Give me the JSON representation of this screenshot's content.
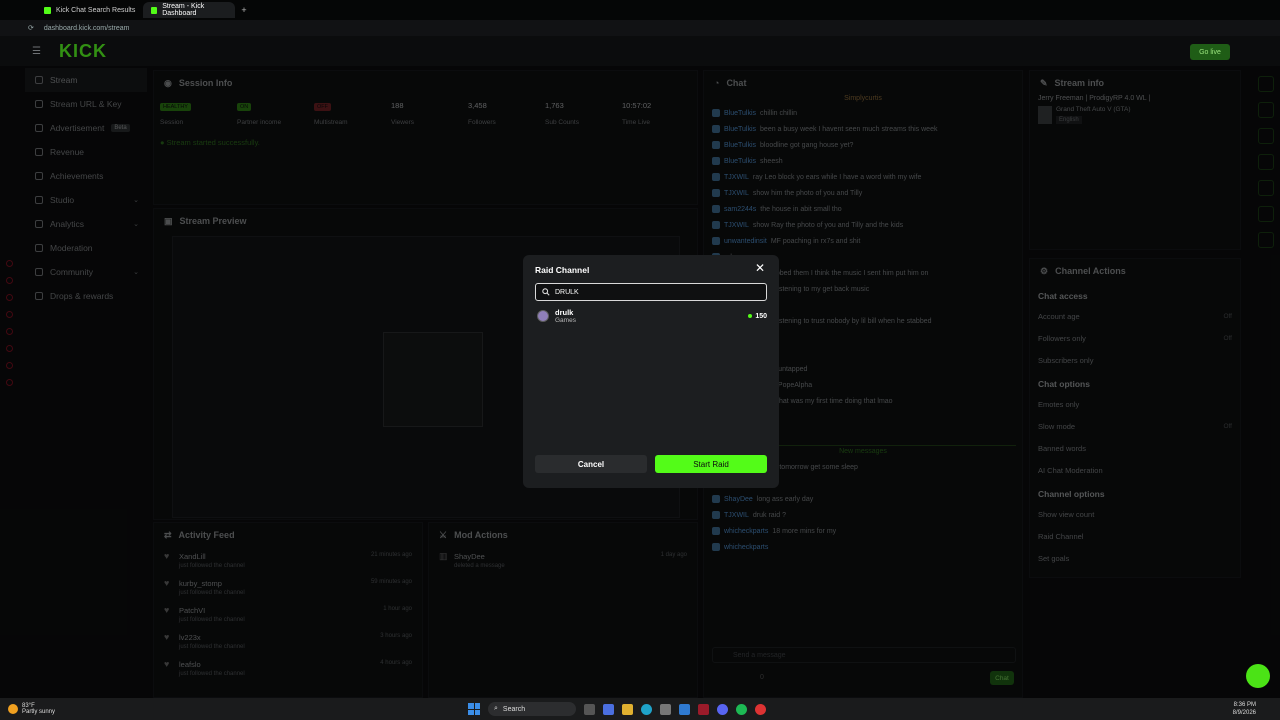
{
  "browser": {
    "tabs": [
      {
        "title": "Kick Chat Search Results",
        "active": false
      },
      {
        "title": "Stream - Kick Dashboard",
        "active": true
      }
    ],
    "url": "dashboard.kick.com/stream"
  },
  "header": {
    "logo": "KICK",
    "go_live": "Go live"
  },
  "sidebar": {
    "items": [
      {
        "label": "Stream",
        "icon": "broadcast-icon",
        "active": true
      },
      {
        "label": "Stream URL & Key",
        "icon": "key-icon"
      },
      {
        "label": "Advertisement",
        "icon": "megaphone-icon",
        "badge": "Beta"
      },
      {
        "label": "Revenue",
        "icon": "dollar-icon"
      },
      {
        "label": "Achievements",
        "icon": "trophy-icon"
      },
      {
        "label": "Studio",
        "icon": "studio-icon",
        "chevron": true
      },
      {
        "label": "Analytics",
        "icon": "chart-icon",
        "chevron": true
      },
      {
        "label": "Moderation",
        "icon": "shield-icon"
      },
      {
        "label": "Community",
        "icon": "people-icon",
        "chevron": true
      },
      {
        "label": "Drops & rewards",
        "icon": "gift-icon"
      }
    ]
  },
  "session": {
    "title": "Session Info",
    "stats": [
      {
        "pill": "HEALTHY",
        "label": "Session",
        "color": "#53fc18"
      },
      {
        "pill": "ON",
        "label": "Partner income",
        "color": "#53fc18"
      },
      {
        "pill": "OFF",
        "label": "Multistream",
        "color": "#e5363a"
      },
      {
        "value": "188",
        "label": "Viewers"
      },
      {
        "value": "3,458",
        "label": "Followers"
      },
      {
        "value": "1,763",
        "label": "Sub Counts"
      },
      {
        "value": "10:57:02",
        "label": "Time Live"
      }
    ],
    "status": "Stream started successfully."
  },
  "preview": {
    "title": "Stream Preview"
  },
  "activity": {
    "title": "Activity Feed",
    "items": [
      {
        "name": "XandLill",
        "sub": "just followed the channel",
        "time": "21 minutes ago"
      },
      {
        "name": "kurby_stomp",
        "sub": "just followed the channel",
        "time": "59 minutes ago"
      },
      {
        "name": "PatchVI",
        "sub": "just followed the channel",
        "time": "1 hour ago"
      },
      {
        "name": "lv223x",
        "sub": "just followed the channel",
        "time": "3 hours ago"
      },
      {
        "name": "leafslo",
        "sub": "just followed the channel",
        "time": "4 hours ago"
      }
    ]
  },
  "mod_actions": {
    "title": "Mod Actions",
    "items": [
      {
        "name": "ShayDee",
        "sub": "deleted a message",
        "time": "1 day ago"
      }
    ]
  },
  "chat": {
    "title": "Chat",
    "pinned": "Simplycurtis",
    "lines": [
      {
        "user": "BlueTulkis",
        "text": "chillin chillin"
      },
      {
        "user": "BlueTulkis",
        "text": "been a busy week I havent seen much streams this week"
      },
      {
        "user": "BlueTulkis",
        "text": "bloodline got gang house yet?"
      },
      {
        "user": "BlueTulkis",
        "text": "sheesh"
      },
      {
        "user": "TJXWIL",
        "text": "ray Leo block yo ears while I have a word with my wife"
      },
      {
        "user": "TJXWIL",
        "text": "show him the photo of you and Tilly"
      },
      {
        "user": "sam2244s",
        "text": "the house in abit small tho"
      },
      {
        "user": "TJXWIL",
        "text": "show Ray the photo of you and Tilly and the kids"
      },
      {
        "user": "unwantedinsit",
        "text": "MF poaching in rx7s and shit"
      },
      {
        "user": "",
        "text": "dream:"
      },
      {
        "user": "",
        "text": "dream: Levi stabbed them I think the music I sent him put him on"
      },
      {
        "user": "",
        "text": "dream: he was listening to my get back music"
      },
      {
        "user": "",
        "text": "dream: lol"
      },
      {
        "user": "",
        "text": "dream: he was listening to trust nobody by lil bill when he stabbed"
      },
      {
        "user": "",
        "text": "levis stream"
      },
      {
        "user": "",
        "text": "is funny"
      },
      {
        "user": "",
        "text": "https://kick.com/untapped"
      },
      {
        "user": "",
        "text": "boom for you @PopeAlpha"
      },
      {
        "user": "",
        "text": "sorry I was late that was my first time doing that lmao"
      },
      {
        "user": "",
        "text": "good shit thug"
      },
      {
        "user": "ShayDee",
        "text": ""
      }
    ],
    "new_messages": "New messages",
    "new_lines": [
      {
        "user": "TJXWIL",
        "text": "see you tomorrow get some sleep"
      },
      {
        "user": "",
        "text": ""
      },
      {
        "user": "ShayDee",
        "text": "long ass early day"
      },
      {
        "user": "TJXWIL",
        "text": "druk raid ?"
      },
      {
        "user": "whicheckparts",
        "text": "18 more mins for my"
      },
      {
        "user": "whicheckparts",
        "text": ""
      }
    ],
    "input_placeholder": "Send a message",
    "send": "Chat",
    "counter": "0"
  },
  "stream_info": {
    "title": "Stream info",
    "stream_title": "Jerry Freeman | ProdigyRP 4.0 WL |",
    "category": "Grand Theft Auto V (GTA)",
    "language": "English"
  },
  "channel_actions": {
    "title": "Channel Actions",
    "sections": [
      {
        "heading": "Chat access",
        "settings": [
          {
            "label": "Account age",
            "state": "Off"
          },
          {
            "label": "Followers only",
            "state": "Off"
          },
          {
            "label": "Subscribers only",
            "state": ""
          }
        ]
      },
      {
        "heading": "Chat options",
        "settings": [
          {
            "label": "Emotes only",
            "state": ""
          },
          {
            "label": "Slow mode",
            "state": "Off"
          },
          {
            "label": "Banned words",
            "state": ""
          },
          {
            "label": "AI Chat Moderation",
            "state": ""
          }
        ]
      },
      {
        "heading": "Channel options",
        "settings": [
          {
            "label": "Show view count",
            "state": ""
          },
          {
            "label": "Raid Channel",
            "state": ""
          },
          {
            "label": "Set goals",
            "state": ""
          }
        ]
      }
    ]
  },
  "modal": {
    "title": "Raid Channel",
    "search_value": "DRULK",
    "result": {
      "name": "drulk",
      "category": "Games",
      "viewers": "150"
    },
    "cancel": "Cancel",
    "confirm": "Start Raid"
  },
  "taskbar": {
    "temp": "83°F",
    "weather": "Partly sunny",
    "search": "Search",
    "time": "8:36 PM",
    "date": "8/9/2026"
  },
  "colors": {
    "accent": "#53fc18",
    "danger": "#e5363a",
    "bg": "#0b0c0d"
  }
}
